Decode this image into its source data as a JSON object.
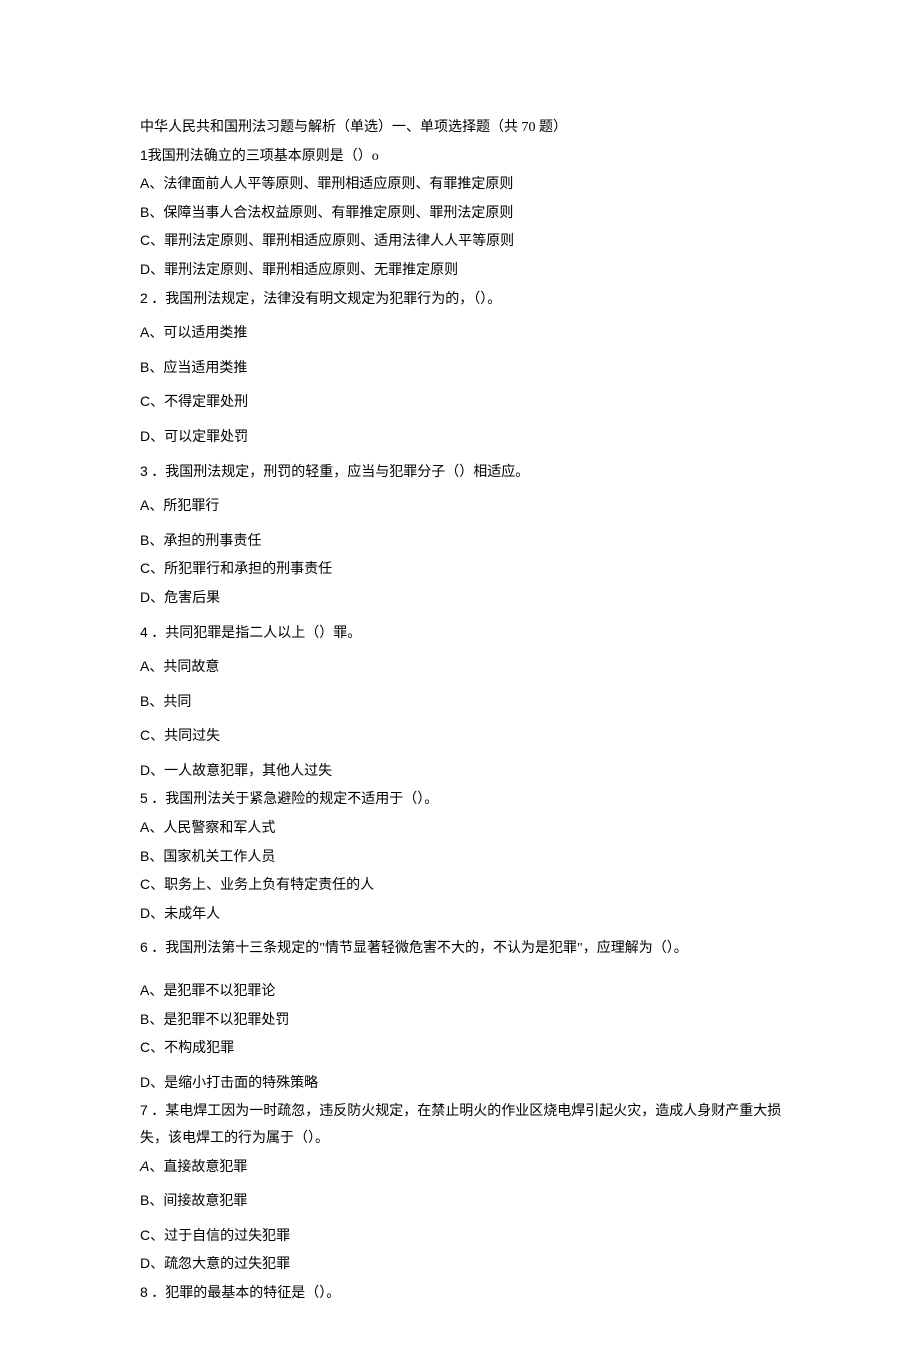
{
  "header": "中华人民共和国刑法习题与解析（单选）一、单项选择题（共 70 题）",
  "questions": [
    {
      "num": "1",
      "text": "我国刑法确立的三项基本原则是（）o",
      "opts": [
        {
          "k": "A",
          "t": "、法律面前人人平等原则、罪刑相适应原则、有罪推定原则"
        },
        {
          "k": "B",
          "t": "、保障当事人合法权益原则、有罪推定原则、罪刑法定原则"
        },
        {
          "k": "C",
          "t": "、罪刑法定原则、罪刑相适应原则、适用法律人人平等原则"
        },
        {
          "k": "D",
          "t": "、罪刑法定原则、罪刑相适应原则、无罪推定原则"
        }
      ]
    },
    {
      "num": "2",
      "text": " ．我国刑法规定，法律没有明文规定为犯罪行为的，（）。",
      "opts": [
        {
          "k": "A",
          "t": "、可以适用类推"
        },
        {
          "k": "B",
          "t": "、应当适用类推"
        },
        {
          "k": "C",
          "t": "、不得定罪处刑"
        },
        {
          "k": "D",
          "t": "、可以定罪处罚"
        }
      ]
    },
    {
      "num": "3",
      "text": " ．我国刑法规定，刑罚的轻重，应当与犯罪分子（）相适应。",
      "opts": [
        {
          "k": "A",
          "t": "、所犯罪行"
        },
        {
          "k": "B",
          "t": "、承担的刑事责任"
        },
        {
          "k": "C",
          "t": "、所犯罪行和承担的刑事责任"
        },
        {
          "k": "D",
          "t": "、危害后果"
        }
      ]
    },
    {
      "num": "4",
      "text": " ．共同犯罪是指二人以上（）罪。",
      "opts": [
        {
          "k": "A",
          "t": "、共同故意"
        },
        {
          "k": "B",
          "t": "、共同"
        },
        {
          "k": "C",
          "t": "、共同过失"
        },
        {
          "k": "D",
          "t": "、一人故意犯罪，其他人过失"
        }
      ]
    },
    {
      "num": "5",
      "text": " ．我国刑法关于紧急避险的规定不适用于（）。",
      "opts": [
        {
          "k": "A",
          "t": "、人民警察和军人式"
        },
        {
          "k": "B",
          "t": "、国家机关工作人员"
        },
        {
          "k": "C",
          "t": "、职务上、业务上负有特定责任的人"
        },
        {
          "k": "D",
          "t": "、未成年人"
        }
      ]
    },
    {
      "num": "6",
      "text": " ．我国刑法第十三条规定的\"情节显著轻微危害不大的，不认为是犯罪\"，应理解为（）。",
      "opts": [
        {
          "k": "A",
          "t": "、是犯罪不以犯罪论"
        },
        {
          "k": "B",
          "t": "、是犯罪不以犯罪处罚"
        },
        {
          "k": "C",
          "t": "、不构成犯罪"
        },
        {
          "k": "D",
          "t": "、是缩小打击面的特殊策略"
        }
      ]
    },
    {
      "num": "7",
      "text": " ．某电焊工因为一时疏忽，违反防火规定，在禁止明火的作业区烧电焊引起火灾，造成人身财产重大损失，该电焊工的行为属于（）。",
      "opts": [
        {
          "k": "A",
          "t": "、直接故意犯罪",
          "italic": true
        },
        {
          "k": "B",
          "t": "、间接故意犯罪"
        },
        {
          "k": "C",
          "t": "、过于自信的过失犯罪"
        },
        {
          "k": "D",
          "t": "、疏忽大意的过失犯罪"
        }
      ]
    },
    {
      "num": "8",
      "text": " ．犯罪的最基本的特征是（）。",
      "opts": []
    }
  ]
}
